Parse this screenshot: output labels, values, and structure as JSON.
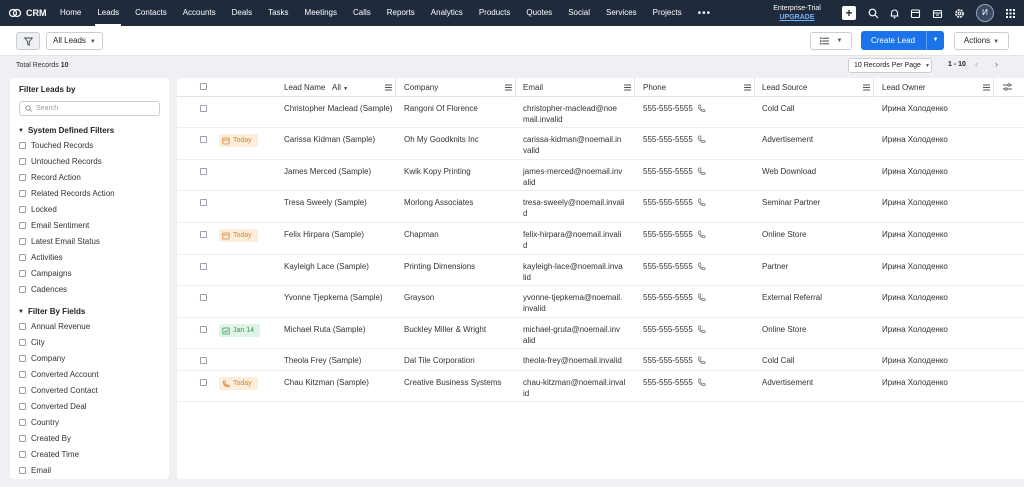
{
  "app": {
    "name": "CRM"
  },
  "nav": {
    "items": [
      "Home",
      "Leads",
      "Contacts",
      "Accounts",
      "Deals",
      "Tasks",
      "Meetings",
      "Calls",
      "Reports",
      "Analytics",
      "Products",
      "Quotes",
      "Social",
      "Services",
      "Projects"
    ],
    "active": "Leads",
    "more": "•••",
    "trial_label": "Enterprise-Trial",
    "upgrade_label": "UPGRADE",
    "avatar_initial": "И",
    "icons": [
      "plus-icon",
      "search-icon",
      "bell-icon",
      "calendar-icon",
      "marketplace-icon",
      "settings-icon",
      "apps-grid-icon"
    ]
  },
  "toolbar": {
    "view_label": "All Leads",
    "create_label": "Create Lead",
    "actions_label": "Actions"
  },
  "summary": {
    "total_label": "Total Records",
    "total_count": "10",
    "per_page": "10 Records Per Page",
    "range": "1 - 10"
  },
  "sidebar": {
    "title": "Filter Leads by",
    "search_placeholder": "Search",
    "system_title": "System Defined Filters",
    "system_filters": [
      "Touched Records",
      "Untouched Records",
      "Record Action",
      "Related Records Action",
      "Locked",
      "Email Sentiment",
      "Latest Email Status",
      "Activities",
      "Campaigns",
      "Cadences"
    ],
    "fields_title": "Filter By Fields",
    "field_filters": [
      "Annual Revenue",
      "City",
      "Company",
      "Converted Account",
      "Converted Contact",
      "Converted Deal",
      "Country",
      "Created By",
      "Created Time",
      "Email"
    ]
  },
  "table": {
    "columns": {
      "lead_name": "Lead Name",
      "lead_name_filter": "All",
      "company": "Company",
      "email": "Email",
      "phone": "Phone",
      "lead_source": "Lead Source",
      "lead_owner": "Lead Owner"
    },
    "rows": [
      {
        "badge": "",
        "badge_type": "",
        "name": "Christopher Maclead (Sample)",
        "company": "Rangoni Of Florence",
        "email1": "christopher-maclead@noe",
        "email2": "mail.invalid",
        "phone": "555-555-5555",
        "source": "Cold Call",
        "owner": "Ирина Холоденко"
      },
      {
        "badge": "Today",
        "badge_type": "task",
        "name": "Carissa Kidman (Sample)",
        "company": "Oh My Goodknits Inc",
        "email1": "carissa-kidman@noemail.in",
        "email2": "valid",
        "phone": "555-555-5555",
        "source": "Advertisement",
        "owner": "Ирина Холоденко"
      },
      {
        "badge": "",
        "badge_type": "",
        "name": "James Merced (Sample)",
        "company": "Kwik Kopy Printing",
        "email1": "james-merced@noemail.inv",
        "email2": "alid",
        "phone": "555-555-5555",
        "source": "Web Download",
        "owner": "Ирина Холоденко"
      },
      {
        "badge": "",
        "badge_type": "",
        "name": "Tresa Sweely (Sample)",
        "company": "Morlong Associates",
        "email1": "tresa-sweely@noemail.invali",
        "email2": "d",
        "phone": "555-555-5555",
        "source": "Seminar Partner",
        "owner": "Ирина Холоденко"
      },
      {
        "badge": "Today",
        "badge_type": "task",
        "name": "Felix Hirpara (Sample)",
        "company": "Chapman",
        "email1": "felix-hirpara@noemail.invali",
        "email2": "d",
        "phone": "555-555-5555",
        "source": "Online Store",
        "owner": "Ирина Холоденко"
      },
      {
        "badge": "",
        "badge_type": "",
        "name": "Kayleigh Lace (Sample)",
        "company": "Printing Dimensions",
        "email1": "kayleigh-lace@noemail.inva",
        "email2": "lid",
        "phone": "555-555-5555",
        "source": "Partner",
        "owner": "Ирина Холоденко"
      },
      {
        "badge": "",
        "badge_type": "",
        "name": "Yvonne Tjepkema (Sample)",
        "company": "Grayson",
        "email1": "yvonne-tjepkema@noemail.",
        "email2": "invalid",
        "phone": "555-555-5555",
        "source": "External Referral",
        "owner": "Ирина Холоденко"
      },
      {
        "badge": "Jan 14",
        "badge_type": "done",
        "name": "Michael Ruta (Sample)",
        "company": "Buckley Miller & Wright",
        "email1": "michael-gruta@noemail.inv",
        "email2": "alid",
        "phone": "555-555-5555",
        "source": "Online Store",
        "owner": "Ирина Холоденко"
      },
      {
        "badge": "",
        "badge_type": "",
        "name": "Theola Frey (Sample)",
        "company": "Dal Tile Corporation",
        "email1": "theola-frey@noemail.invalid",
        "email2": "",
        "phone": "555-555-5555",
        "source": "Cold Call",
        "owner": "Ирина Холоденко"
      },
      {
        "badge": "Today",
        "badge_type": "call",
        "name": "Chau Kitzman (Sample)",
        "company": "Creative Business Systems",
        "email1": "chau-kitzman@noemail.inval",
        "email2": "id",
        "phone": "555-555-5555",
        "source": "Advertisement",
        "owner": "Ирина Холоденко"
      }
    ]
  },
  "colors": {
    "nav_bg": "#1f2a3c",
    "primary": "#1a73e8",
    "badge_orange": "#d9822b",
    "badge_green": "#2e9b55"
  }
}
